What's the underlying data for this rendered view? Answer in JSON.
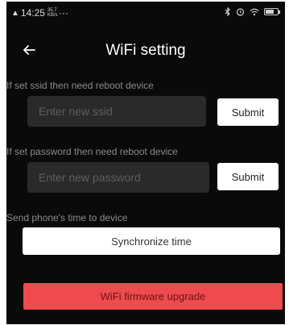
{
  "status_bar": {
    "signal": "4G",
    "time": "14:25",
    "speed": "35.7 KB/s",
    "dots": "···",
    "icons": [
      "bluetooth-icon",
      "alarm-icon",
      "wifi-icon",
      "battery-icon"
    ]
  },
  "header": {
    "title": "WiFi setting",
    "back_icon": "arrow-left-icon"
  },
  "ssid_section": {
    "label": "If set ssid then need reboot device",
    "placeholder": "Enter new ssid",
    "value": "",
    "submit_label": "Submit"
  },
  "password_section": {
    "label": "If set password then need reboot device",
    "placeholder": "Enter new password",
    "value": "",
    "submit_label": "Submit"
  },
  "time_section": {
    "label": "Send phone's time to device",
    "button_label": "Synchronize time"
  },
  "upgrade": {
    "button_label": "WiFi firmware upgrade"
  },
  "colors": {
    "background": "#0a0a0a",
    "input_background": "#2a2a2a",
    "label_text": "#8a8a8a",
    "accent_red": "#ef4a4e"
  }
}
